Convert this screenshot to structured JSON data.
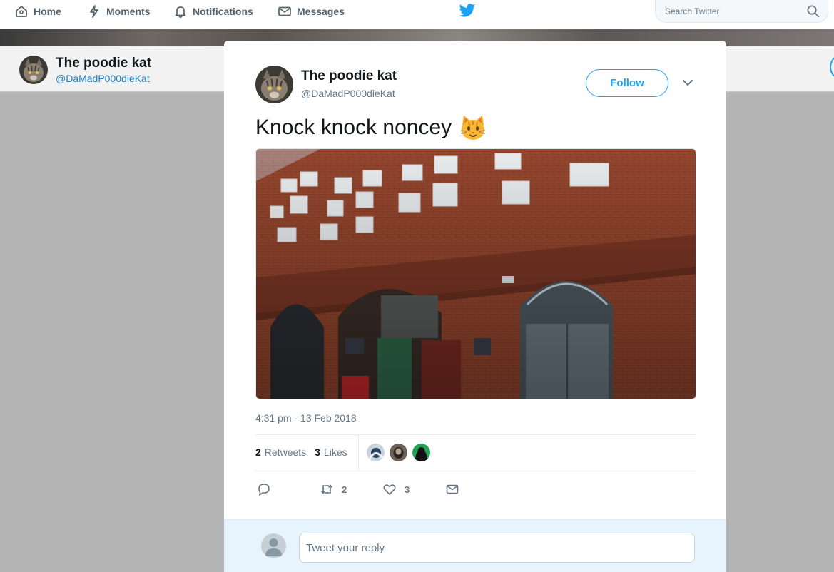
{
  "nav": {
    "items": [
      {
        "label": "Home",
        "icon": "home-icon"
      },
      {
        "label": "Moments",
        "icon": "lightning-icon"
      },
      {
        "label": "Notifications",
        "icon": "bell-icon"
      },
      {
        "label": "Messages",
        "icon": "envelope-icon"
      }
    ],
    "logo_icon": "twitter-bird-icon",
    "search_placeholder": "Search Twitter",
    "search_icon": "search-icon"
  },
  "profile": {
    "name": "The poodie kat",
    "handle": "@DaMadP000dieKat"
  },
  "tweet": {
    "name": "The poodie kat",
    "handle": "@DaMadP000dieKat",
    "follow_label": "Follow",
    "text": "Knock knock noncey",
    "emoji_icon": "cat-face-emoji",
    "timestamp": "4:31 pm - 13 Feb 2018",
    "retweets_count": "2",
    "retweets_label": "Retweets",
    "likes_count": "3",
    "likes_label": "Likes",
    "actions": {
      "reply_count": "",
      "retweet_count": "2",
      "like_count": "3"
    }
  },
  "reply": {
    "placeholder": "Tweet your reply"
  },
  "colors": {
    "accent": "#1da1f2",
    "muted": "#657786",
    "overlay": "#b4b4b4",
    "brick": "#9c4a33"
  }
}
